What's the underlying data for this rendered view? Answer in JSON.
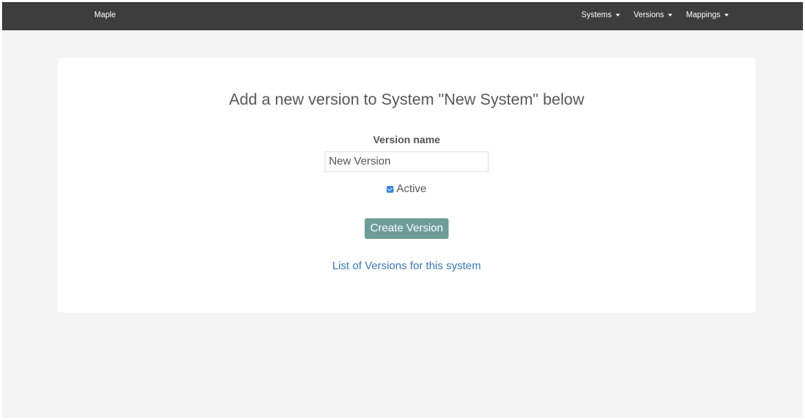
{
  "navbar": {
    "brand": "Maple",
    "menus": [
      {
        "label": "Systems"
      },
      {
        "label": "Versions"
      },
      {
        "label": "Mappings"
      }
    ]
  },
  "form": {
    "title": "Add a new version to System \"New System\" below",
    "version_name_label": "Version name",
    "version_name_value": "New Version",
    "active_label": "Active",
    "active_checked": true,
    "submit_label": "Create Version",
    "list_link": "List of Versions for this system"
  },
  "colors": {
    "navbar_bg": "#3d3d3d",
    "page_bg": "#f4f4f4",
    "button_bg": "#6e9d99",
    "link": "#3a76b3",
    "checkbox": "#3a86e0"
  }
}
